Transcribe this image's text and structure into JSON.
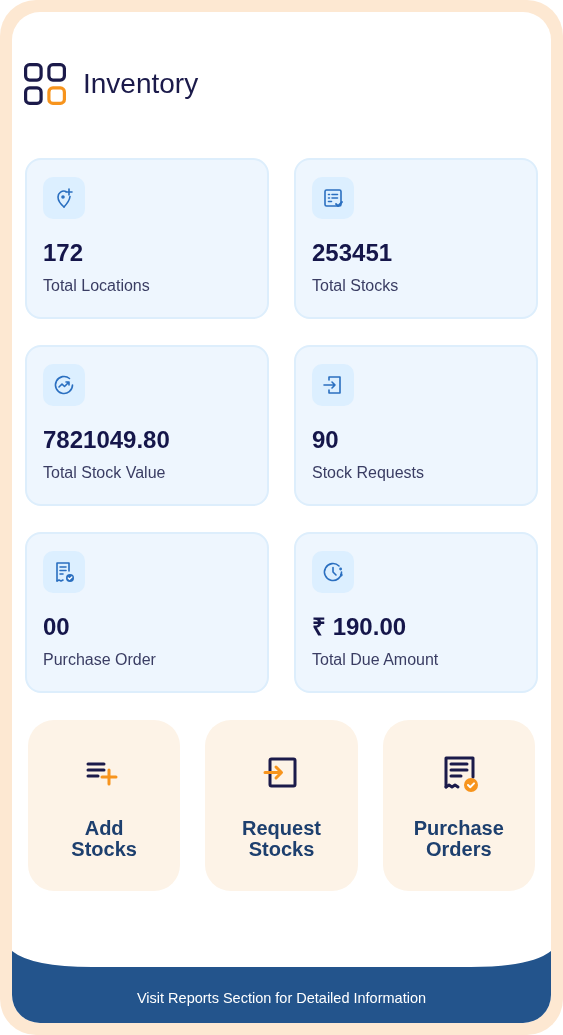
{
  "header": {
    "title": "Inventory"
  },
  "stats": [
    {
      "value": "172",
      "label": "Total Locations"
    },
    {
      "value": "253451",
      "label": "Total Stocks"
    },
    {
      "value": "7821049.80",
      "label": "Total Stock Value"
    },
    {
      "value": "90",
      "label": "Stock Requests"
    },
    {
      "value": "00",
      "label": "Purchase Order"
    },
    {
      "value": "₹ 190.00",
      "label": "Total Due Amount"
    }
  ],
  "actions": [
    {
      "label": "Add Stocks"
    },
    {
      "label": "Request Stocks"
    },
    {
      "label": "Purchase Orders"
    }
  ],
  "footer": {
    "text": "Visit Reports Section for Detailed Information"
  }
}
